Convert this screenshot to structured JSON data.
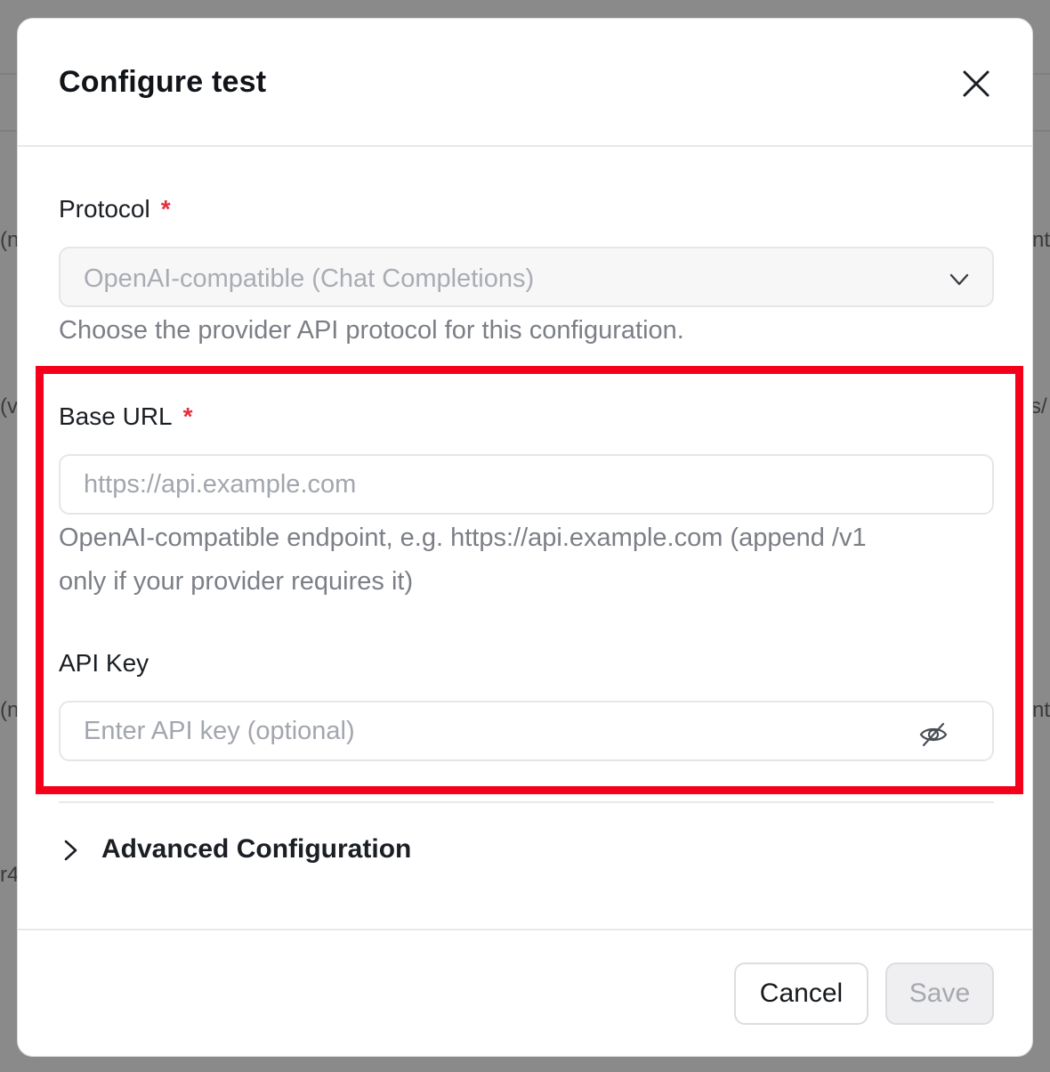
{
  "background": {
    "fragments": [
      "(n",
      "nt",
      "(v",
      "s/",
      "(n",
      "nt",
      "r4"
    ]
  },
  "modal": {
    "title": "Configure test",
    "close_icon": "close-icon"
  },
  "protocol": {
    "label": "Protocol",
    "required_mark": "*",
    "selected": "OpenAI-compatible (Chat Completions)",
    "help": "Choose the provider API protocol for this configuration."
  },
  "base_url": {
    "label": "Base URL",
    "required_mark": "*",
    "value": "",
    "placeholder": "https://api.example.com",
    "help_line1": "OpenAI-compatible endpoint, e.g. https://api.example.com (append /v1",
    "help_line2": "only if your provider requires it)"
  },
  "api_key": {
    "label": "API Key",
    "value": "",
    "placeholder": "Enter API key (optional)",
    "toggle_icon": "eye-off-icon"
  },
  "advanced": {
    "label": "Advanced Configuration",
    "icon": "chevron-right-icon"
  },
  "footer": {
    "cancel_label": "Cancel",
    "save_label": "Save"
  },
  "colors": {
    "required": "#e5303e",
    "highlight": "#f5001b"
  }
}
